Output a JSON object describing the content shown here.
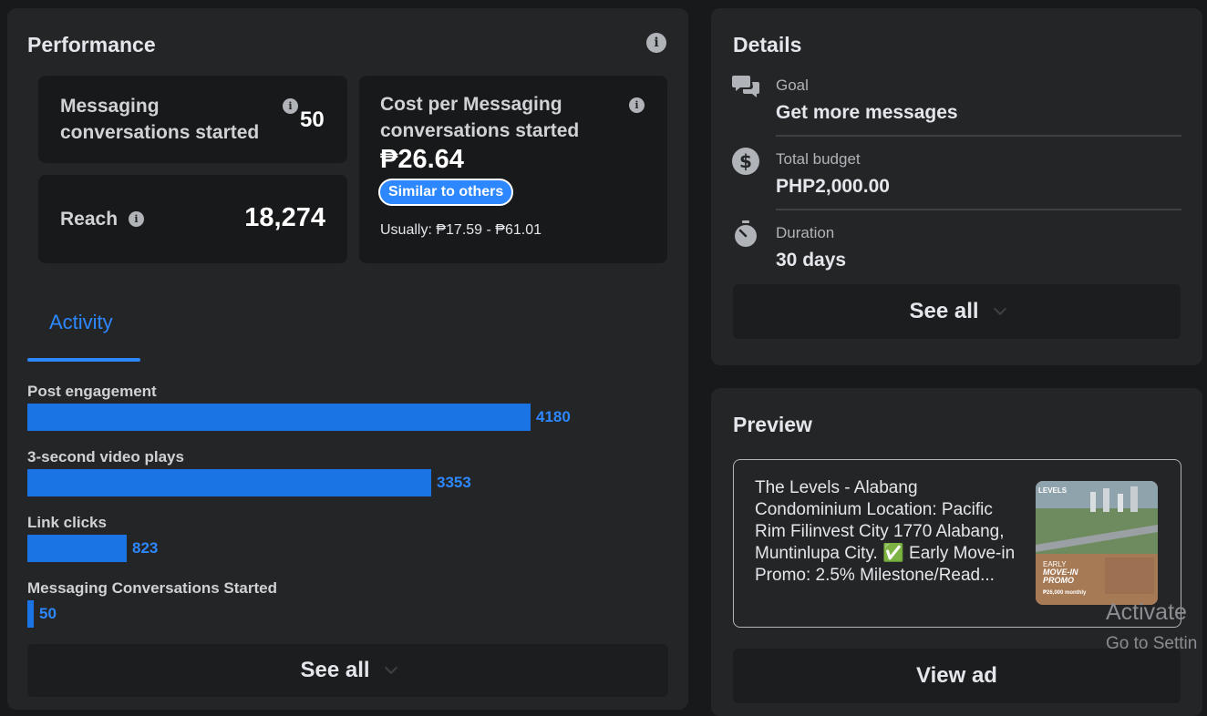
{
  "performance": {
    "title": "Performance",
    "metrics": {
      "messaging_label": "Messaging conversations started",
      "messaging_value": "50",
      "reach_label": "Reach",
      "reach_value": "18,274",
      "cost_label": "Cost per Messaging conversations started",
      "cost_value": "₱26.64",
      "cost_badge": "Similar to others",
      "cost_usually": "Usually: ₱17.59 - ₱61.01"
    },
    "tab": "Activity",
    "activity": [
      {
        "label": "Post engagement",
        "value": 4180
      },
      {
        "label": "3-second video plays",
        "value": 3353
      },
      {
        "label": "Link clicks",
        "value": 823
      },
      {
        "label": "Messaging Conversations Started",
        "value": 50
      }
    ],
    "see_all": "See all"
  },
  "details": {
    "title": "Details",
    "goal_label": "Goal",
    "goal_value": "Get more messages",
    "budget_label": "Total budget",
    "budget_value": "PHP2,000.00",
    "duration_label": "Duration",
    "duration_value": "30 days",
    "see_all": "See all"
  },
  "preview": {
    "title": "Preview",
    "ad_text": "The Levels - Alabang Condominium Location: Pacific Rim Filinvest City 1770 Alabang, Muntinlupa City. ✅ Early Move-in Promo: 2.5% Milestone/Read...",
    "thumb": {
      "brand": "LEVELS",
      "headline_1": "EARLY",
      "headline_2": "MOVE-IN",
      "headline_3": "PROMO",
      "price": "₱26,000 monthly"
    },
    "view_ad": "View ad"
  },
  "watermark": {
    "line1": "Activate",
    "line2": "Go to Settin"
  },
  "colors": {
    "accent": "#2d88ff",
    "bar": "#1b74e4",
    "panel": "#242526",
    "background": "#18191a"
  }
}
